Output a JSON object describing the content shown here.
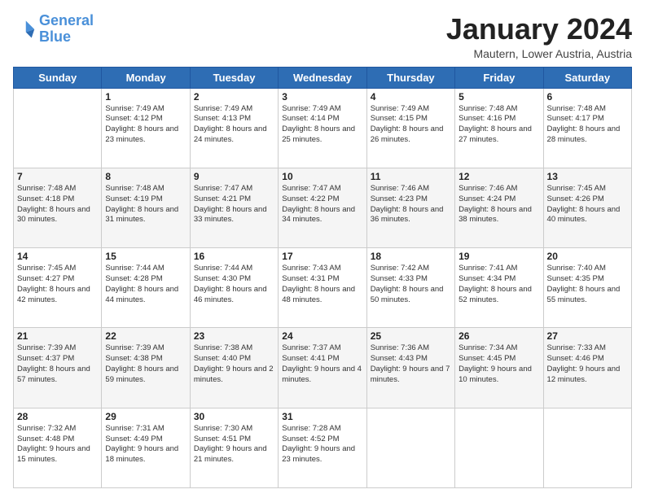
{
  "header": {
    "logo_line1": "General",
    "logo_line2": "Blue",
    "title": "January 2024",
    "subtitle": "Mautern, Lower Austria, Austria"
  },
  "weekdays": [
    "Sunday",
    "Monday",
    "Tuesday",
    "Wednesday",
    "Thursday",
    "Friday",
    "Saturday"
  ],
  "weeks": [
    [
      {
        "day": "",
        "sunrise": "",
        "sunset": "",
        "daylight": ""
      },
      {
        "day": "1",
        "sunrise": "Sunrise: 7:49 AM",
        "sunset": "Sunset: 4:12 PM",
        "daylight": "Daylight: 8 hours and 23 minutes."
      },
      {
        "day": "2",
        "sunrise": "Sunrise: 7:49 AM",
        "sunset": "Sunset: 4:13 PM",
        "daylight": "Daylight: 8 hours and 24 minutes."
      },
      {
        "day": "3",
        "sunrise": "Sunrise: 7:49 AM",
        "sunset": "Sunset: 4:14 PM",
        "daylight": "Daylight: 8 hours and 25 minutes."
      },
      {
        "day": "4",
        "sunrise": "Sunrise: 7:49 AM",
        "sunset": "Sunset: 4:15 PM",
        "daylight": "Daylight: 8 hours and 26 minutes."
      },
      {
        "day": "5",
        "sunrise": "Sunrise: 7:48 AM",
        "sunset": "Sunset: 4:16 PM",
        "daylight": "Daylight: 8 hours and 27 minutes."
      },
      {
        "day": "6",
        "sunrise": "Sunrise: 7:48 AM",
        "sunset": "Sunset: 4:17 PM",
        "daylight": "Daylight: 8 hours and 28 minutes."
      }
    ],
    [
      {
        "day": "7",
        "sunrise": "Sunrise: 7:48 AM",
        "sunset": "Sunset: 4:18 PM",
        "daylight": "Daylight: 8 hours and 30 minutes."
      },
      {
        "day": "8",
        "sunrise": "Sunrise: 7:48 AM",
        "sunset": "Sunset: 4:19 PM",
        "daylight": "Daylight: 8 hours and 31 minutes."
      },
      {
        "day": "9",
        "sunrise": "Sunrise: 7:47 AM",
        "sunset": "Sunset: 4:21 PM",
        "daylight": "Daylight: 8 hours and 33 minutes."
      },
      {
        "day": "10",
        "sunrise": "Sunrise: 7:47 AM",
        "sunset": "Sunset: 4:22 PM",
        "daylight": "Daylight: 8 hours and 34 minutes."
      },
      {
        "day": "11",
        "sunrise": "Sunrise: 7:46 AM",
        "sunset": "Sunset: 4:23 PM",
        "daylight": "Daylight: 8 hours and 36 minutes."
      },
      {
        "day": "12",
        "sunrise": "Sunrise: 7:46 AM",
        "sunset": "Sunset: 4:24 PM",
        "daylight": "Daylight: 8 hours and 38 minutes."
      },
      {
        "day": "13",
        "sunrise": "Sunrise: 7:45 AM",
        "sunset": "Sunset: 4:26 PM",
        "daylight": "Daylight: 8 hours and 40 minutes."
      }
    ],
    [
      {
        "day": "14",
        "sunrise": "Sunrise: 7:45 AM",
        "sunset": "Sunset: 4:27 PM",
        "daylight": "Daylight: 8 hours and 42 minutes."
      },
      {
        "day": "15",
        "sunrise": "Sunrise: 7:44 AM",
        "sunset": "Sunset: 4:28 PM",
        "daylight": "Daylight: 8 hours and 44 minutes."
      },
      {
        "day": "16",
        "sunrise": "Sunrise: 7:44 AM",
        "sunset": "Sunset: 4:30 PM",
        "daylight": "Daylight: 8 hours and 46 minutes."
      },
      {
        "day": "17",
        "sunrise": "Sunrise: 7:43 AM",
        "sunset": "Sunset: 4:31 PM",
        "daylight": "Daylight: 8 hours and 48 minutes."
      },
      {
        "day": "18",
        "sunrise": "Sunrise: 7:42 AM",
        "sunset": "Sunset: 4:33 PM",
        "daylight": "Daylight: 8 hours and 50 minutes."
      },
      {
        "day": "19",
        "sunrise": "Sunrise: 7:41 AM",
        "sunset": "Sunset: 4:34 PM",
        "daylight": "Daylight: 8 hours and 52 minutes."
      },
      {
        "day": "20",
        "sunrise": "Sunrise: 7:40 AM",
        "sunset": "Sunset: 4:35 PM",
        "daylight": "Daylight: 8 hours and 55 minutes."
      }
    ],
    [
      {
        "day": "21",
        "sunrise": "Sunrise: 7:39 AM",
        "sunset": "Sunset: 4:37 PM",
        "daylight": "Daylight: 8 hours and 57 minutes."
      },
      {
        "day": "22",
        "sunrise": "Sunrise: 7:39 AM",
        "sunset": "Sunset: 4:38 PM",
        "daylight": "Daylight: 8 hours and 59 minutes."
      },
      {
        "day": "23",
        "sunrise": "Sunrise: 7:38 AM",
        "sunset": "Sunset: 4:40 PM",
        "daylight": "Daylight: 9 hours and 2 minutes."
      },
      {
        "day": "24",
        "sunrise": "Sunrise: 7:37 AM",
        "sunset": "Sunset: 4:41 PM",
        "daylight": "Daylight: 9 hours and 4 minutes."
      },
      {
        "day": "25",
        "sunrise": "Sunrise: 7:36 AM",
        "sunset": "Sunset: 4:43 PM",
        "daylight": "Daylight: 9 hours and 7 minutes."
      },
      {
        "day": "26",
        "sunrise": "Sunrise: 7:34 AM",
        "sunset": "Sunset: 4:45 PM",
        "daylight": "Daylight: 9 hours and 10 minutes."
      },
      {
        "day": "27",
        "sunrise": "Sunrise: 7:33 AM",
        "sunset": "Sunset: 4:46 PM",
        "daylight": "Daylight: 9 hours and 12 minutes."
      }
    ],
    [
      {
        "day": "28",
        "sunrise": "Sunrise: 7:32 AM",
        "sunset": "Sunset: 4:48 PM",
        "daylight": "Daylight: 9 hours and 15 minutes."
      },
      {
        "day": "29",
        "sunrise": "Sunrise: 7:31 AM",
        "sunset": "Sunset: 4:49 PM",
        "daylight": "Daylight: 9 hours and 18 minutes."
      },
      {
        "day": "30",
        "sunrise": "Sunrise: 7:30 AM",
        "sunset": "Sunset: 4:51 PM",
        "daylight": "Daylight: 9 hours and 21 minutes."
      },
      {
        "day": "31",
        "sunrise": "Sunrise: 7:28 AM",
        "sunset": "Sunset: 4:52 PM",
        "daylight": "Daylight: 9 hours and 23 minutes."
      },
      {
        "day": "",
        "sunrise": "",
        "sunset": "",
        "daylight": ""
      },
      {
        "day": "",
        "sunrise": "",
        "sunset": "",
        "daylight": ""
      },
      {
        "day": "",
        "sunrise": "",
        "sunset": "",
        "daylight": ""
      }
    ]
  ]
}
